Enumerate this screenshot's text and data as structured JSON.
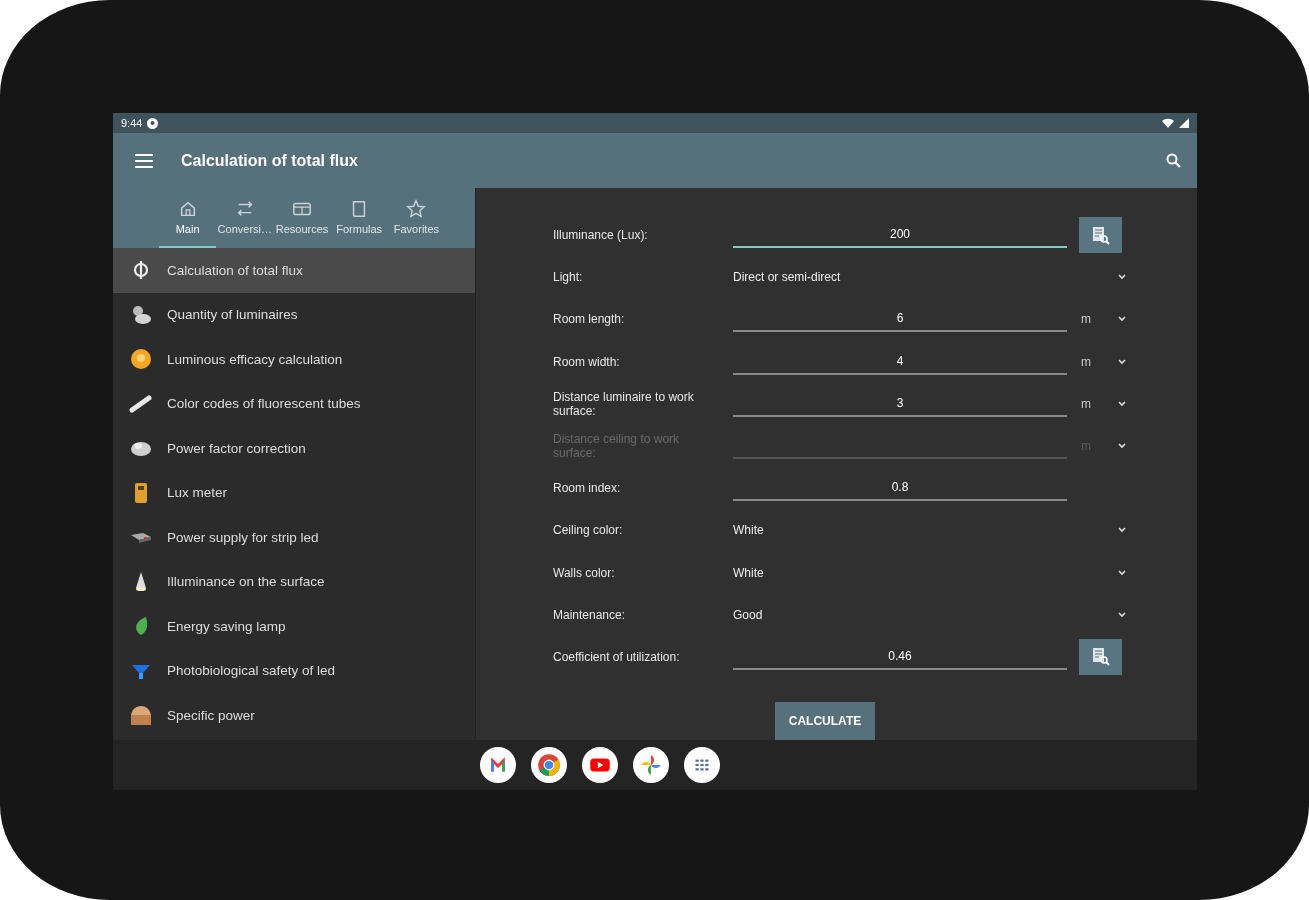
{
  "status_bar": {
    "time": "9:44"
  },
  "app_bar": {
    "title": "Calculation of total flux"
  },
  "tabs": [
    {
      "label": "Main",
      "selected": true
    },
    {
      "label": "Conversi…",
      "selected": false
    },
    {
      "label": "Resources",
      "selected": false
    },
    {
      "label": "Formulas",
      "selected": false
    },
    {
      "label": "Favorites",
      "selected": false
    }
  ],
  "sidebar": {
    "items": [
      {
        "label": "Calculation of total flux",
        "selected": true
      },
      {
        "label": "Quantity of luminaires",
        "selected": false
      },
      {
        "label": "Luminous efficacy calculation",
        "selected": false
      },
      {
        "label": "Color codes of fluorescent tubes",
        "selected": false
      },
      {
        "label": "Power factor correction",
        "selected": false
      },
      {
        "label": "Lux meter",
        "selected": false
      },
      {
        "label": "Power supply for strip led",
        "selected": false
      },
      {
        "label": "Illuminance on the surface",
        "selected": false
      },
      {
        "label": "Energy saving lamp",
        "selected": false
      },
      {
        "label": "Photobiological safety of led",
        "selected": false
      },
      {
        "label": "Specific power",
        "selected": false
      }
    ]
  },
  "form": {
    "fields": [
      {
        "kind": "input",
        "label": "Illuminance (Lux):",
        "value": "200",
        "focused": true,
        "disabled": false,
        "lookup": true
      },
      {
        "kind": "select",
        "label": "Light:",
        "value": "Direct or semi-direct"
      },
      {
        "kind": "input",
        "label": "Room length:",
        "value": "6",
        "unit": "m",
        "focused": false,
        "disabled": false
      },
      {
        "kind": "input",
        "label": "Room width:",
        "value": "4",
        "unit": "m",
        "focused": false,
        "disabled": false
      },
      {
        "kind": "input",
        "label": "Distance luminaire to work surface:",
        "value": "3",
        "unit": "m",
        "focused": false,
        "disabled": false
      },
      {
        "kind": "input",
        "label": "Distance ceiling to work surface:",
        "unit": "m",
        "focused": false,
        "disabled": true
      },
      {
        "kind": "input",
        "label": "Room index:",
        "value": "0.8",
        "focused": false,
        "disabled": false
      },
      {
        "kind": "select",
        "label": "Ceiling color:",
        "value": "White"
      },
      {
        "kind": "select",
        "label": "Walls color:",
        "value": "White"
      },
      {
        "kind": "select",
        "label": "Maintenance:",
        "value": "Good"
      },
      {
        "kind": "input",
        "label": "Coefficient of utilization:",
        "value": "0.46",
        "focused": false,
        "disabled": false,
        "lookup": true
      }
    ],
    "button": "CALCULATE"
  }
}
